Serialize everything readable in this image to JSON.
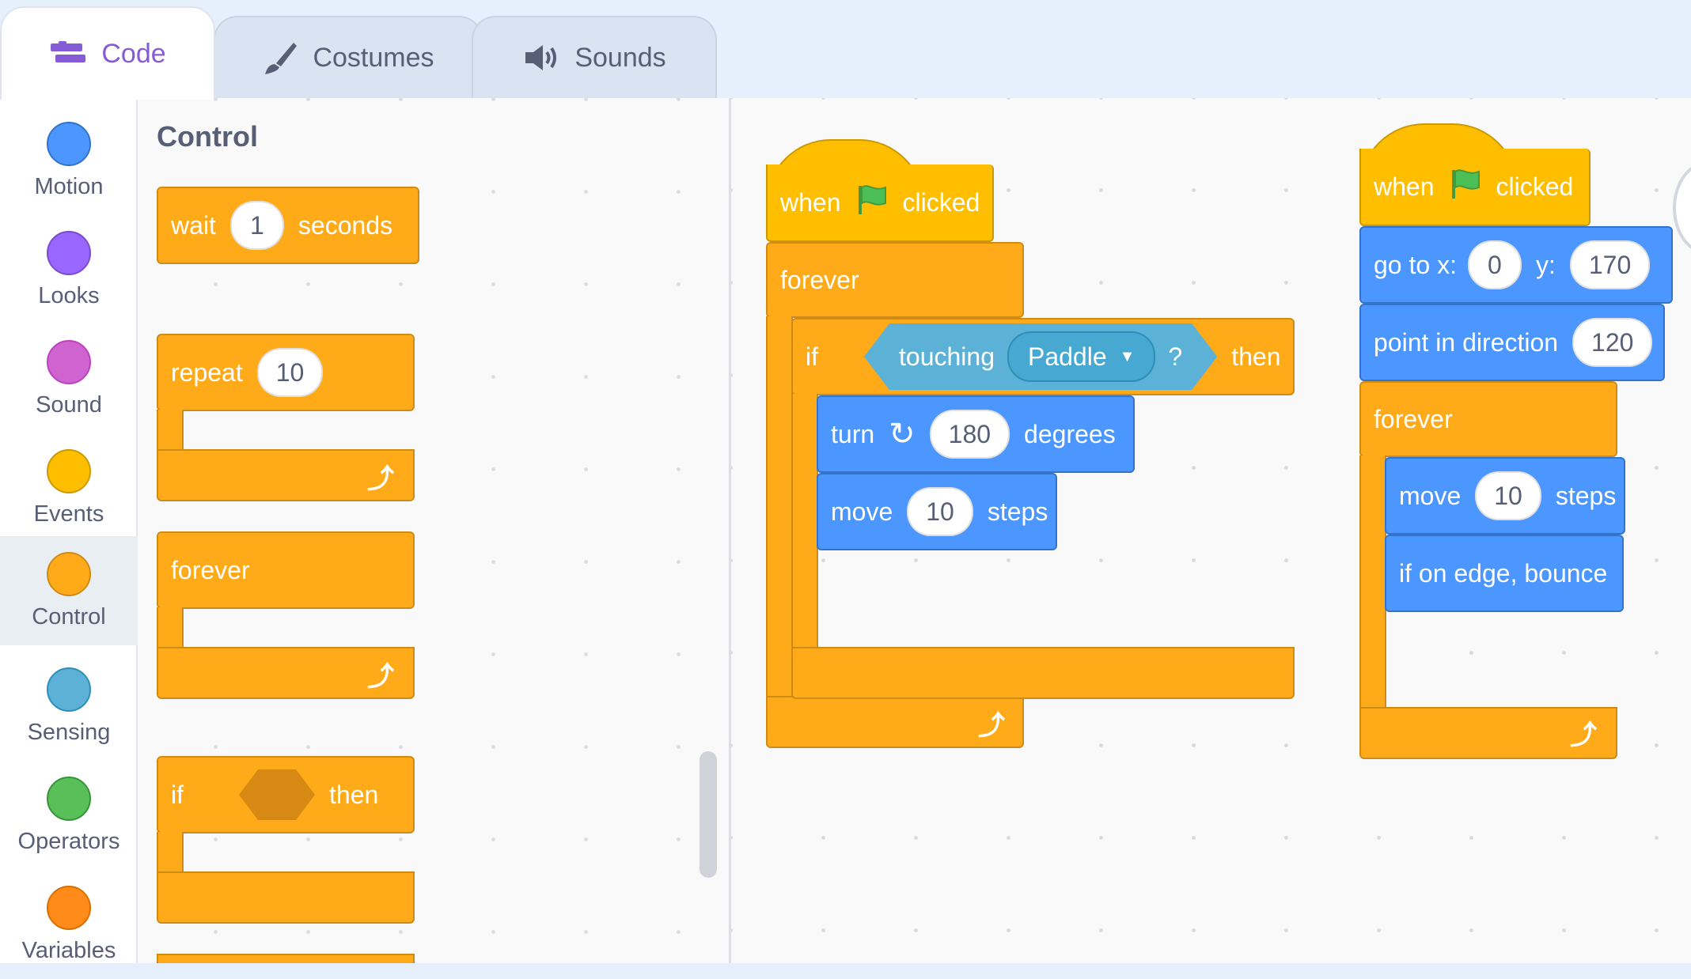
{
  "tabs": [
    {
      "label": "Code",
      "icon": "code-icon",
      "active": true
    },
    {
      "label": "Costumes",
      "icon": "paintbrush-icon",
      "active": false
    },
    {
      "label": "Sounds",
      "icon": "speaker-icon",
      "active": false
    }
  ],
  "categories": [
    {
      "label": "Motion",
      "color": "#4c97ff"
    },
    {
      "label": "Looks",
      "color": "#9966ff"
    },
    {
      "label": "Sound",
      "color": "#cf63cf"
    },
    {
      "label": "Events",
      "color": "#ffbf00"
    },
    {
      "label": "Control",
      "color": "#ffab19",
      "selected": true
    },
    {
      "label": "Sensing",
      "color": "#5cb1d6"
    },
    {
      "label": "Operators",
      "color": "#59c059"
    },
    {
      "label": "Variables",
      "color": "#ff8c1a"
    }
  ],
  "palette": {
    "title": "Control",
    "wait": {
      "label": "wait",
      "value": "1",
      "unit": "seconds"
    },
    "repeat": {
      "label": "repeat",
      "value": "10"
    },
    "forever": {
      "label": "forever"
    },
    "if_then": {
      "if": "if",
      "then": "then"
    }
  },
  "script1": {
    "hat": {
      "when": "when",
      "clicked": "clicked"
    },
    "forever": "forever",
    "if": {
      "if": "if",
      "touching": "touching",
      "target": "Paddle",
      "question": "?",
      "then": "then"
    },
    "turn": {
      "label": "turn",
      "value": "180",
      "unit": "degrees"
    },
    "move": {
      "label": "move",
      "value": "10",
      "unit": "steps"
    }
  },
  "script2": {
    "hat": {
      "when": "when",
      "clicked": "clicked"
    },
    "goto": {
      "label": "go to x:",
      "x": "0",
      "ylabel": "y:",
      "y": "170"
    },
    "point": {
      "label": "point in direction",
      "value": "120"
    },
    "forever": "forever",
    "move": {
      "label": "move",
      "value": "10",
      "unit": "steps"
    },
    "bounce": "if on edge, bounce"
  }
}
